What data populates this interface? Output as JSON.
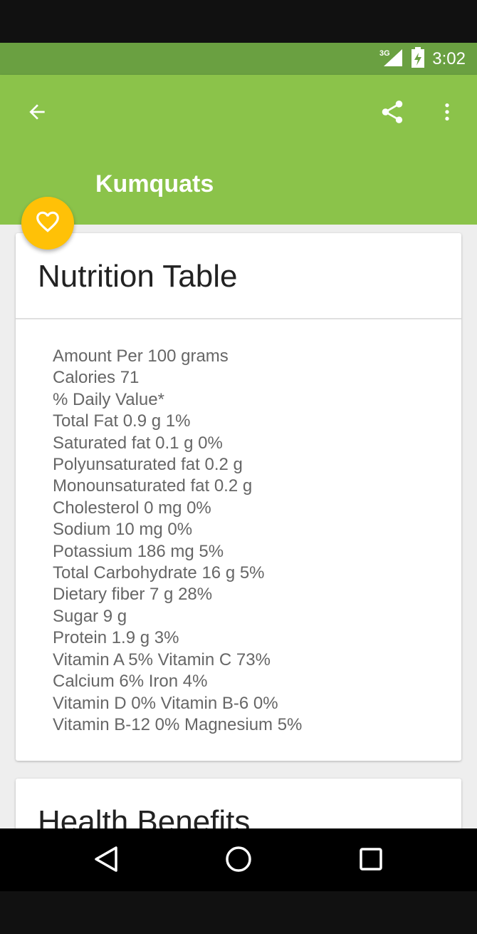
{
  "status_bar": {
    "network": "3G",
    "time": "3:02"
  },
  "app_bar": {
    "title": "Kumquats",
    "back_icon": "arrow-back-icon",
    "share_icon": "share-icon",
    "more_icon": "more-vert-icon"
  },
  "fab": {
    "icon": "heart-outline-icon"
  },
  "nutrition_card": {
    "title": "Nutrition Table",
    "rows": [
      "Amount Per 100 grams",
      "Calories 71",
      "% Daily Value*",
      "Total Fat 0.9 g  1%",
      "Saturated fat 0.1 g  0%",
      "Polyunsaturated fat 0.2 g",
      "Monounsaturated fat 0.2 g",
      "Cholesterol 0 mg 0%",
      "Sodium 10 mg 0%",
      "Potassium 186 mg 5%",
      "Total Carbohydrate 16 g  5%",
      "Dietary fiber 7 g 28%",
      "Sugar 9 g",
      "Protein 1.9 g 3%",
      "Vitamin A  5% Vitamin C  73%",
      "Calcium 6% Iron 4%",
      "Vitamin D  0% Vitamin B-6 0%",
      "Vitamin B-12  0% Magnesium  5%"
    ]
  },
  "health_card": {
    "title": "Health Benefits"
  },
  "nav_bar": {
    "back": "nav-back-icon",
    "home": "nav-home-icon",
    "recents": "nav-recents-icon"
  },
  "colors": {
    "app_bar": "#8bc34a",
    "status_bar": "#6aa041",
    "fab": "#ffc107"
  }
}
